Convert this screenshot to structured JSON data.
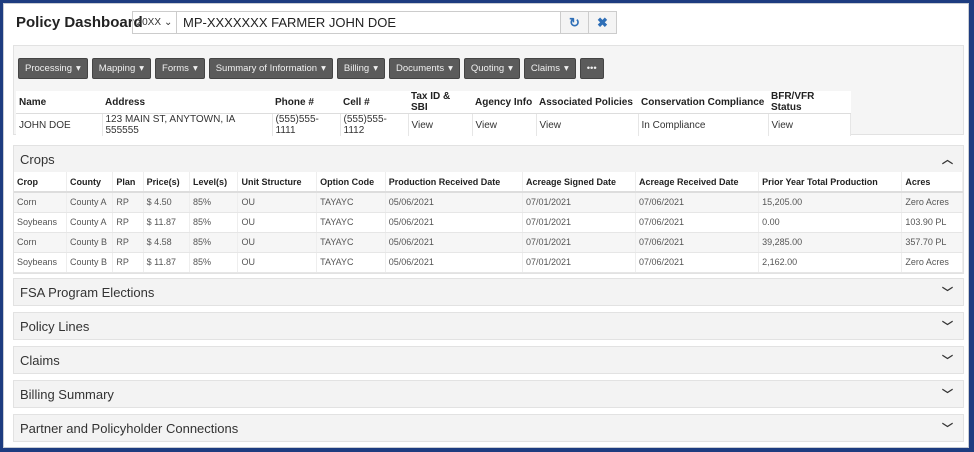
{
  "header": {
    "title": "Policy Dashboard",
    "year": "20XX",
    "policy": "MP-XXXXXXX FARMER JOHN DOE"
  },
  "toolbar": [
    "Processing",
    "Mapping",
    "Forms",
    "Summary of Information",
    "Billing",
    "Documents",
    "Quoting",
    "Claims"
  ],
  "more_label": "•••",
  "info": {
    "headers": [
      "Name",
      "Address",
      "Phone #",
      "Cell #",
      "Tax ID & SBI",
      "Agency Info",
      "Associated Policies",
      "Conservation Compliance",
      "BFR/VFR Status"
    ],
    "row": [
      "JOHN DOE",
      "123 MAIN ST, ANYTOWN, IA 555555",
      "(555)555-1111",
      "(555)555-1112",
      "View",
      "View",
      "View",
      "In Compliance",
      "View"
    ]
  },
  "crops": {
    "title": "Crops",
    "headers": [
      "Crop",
      "County",
      "Plan",
      "Price(s)",
      "Level(s)",
      "Unit Structure",
      "Option Code",
      "Production Received Date",
      "Acreage Signed Date",
      "Acreage Received Date",
      "Prior Year Total Production",
      "Acres"
    ],
    "rows": [
      [
        "Corn",
        "County A",
        "RP",
        "$ 4.50",
        "85%",
        "OU",
        "TAYAYC",
        "05/06/2021",
        "07/01/2021",
        "07/06/2021",
        "15,205.00",
        "Zero Acres"
      ],
      [
        "Soybeans",
        "County A",
        "RP",
        "$ 11.87",
        "85%",
        "OU",
        "TAYAYC",
        "05/06/2021",
        "07/01/2021",
        "07/06/2021",
        "0.00",
        "103.90 PL"
      ],
      [
        "Corn",
        "County B",
        "RP",
        "$ 4.58",
        "85%",
        "OU",
        "TAYAYC",
        "05/06/2021",
        "07/01/2021",
        "07/06/2021",
        "39,285.00",
        "357.70 PL"
      ],
      [
        "Soybeans",
        "County B",
        "RP",
        "$ 11.87",
        "85%",
        "OU",
        "TAYAYC",
        "05/06/2021",
        "07/01/2021",
        "07/06/2021",
        "2,162.00",
        "Zero Acres"
      ]
    ]
  },
  "sections": [
    "FSA Program Elections",
    "Policy Lines",
    "Claims",
    "Billing Summary",
    "Partner and Policyholder Connections"
  ]
}
